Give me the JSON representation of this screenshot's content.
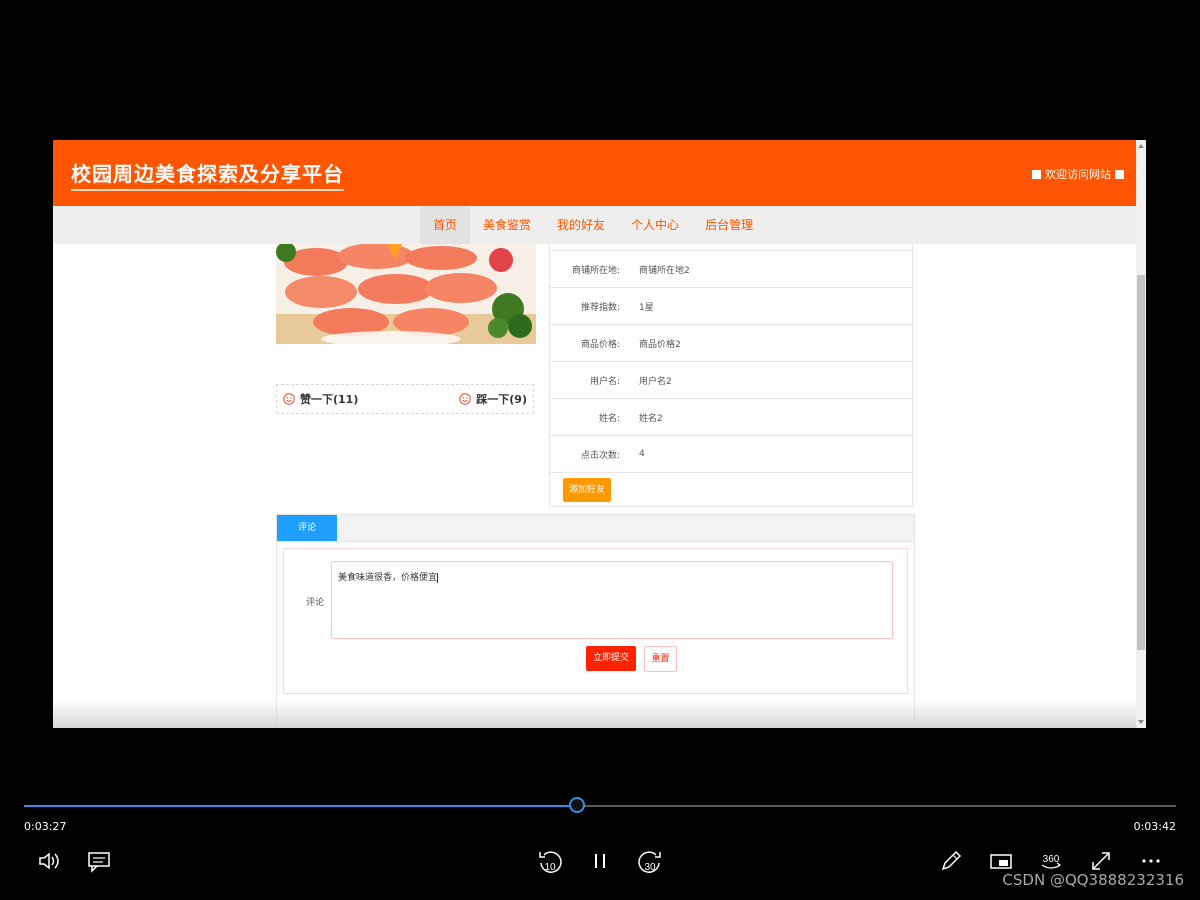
{
  "site": {
    "title": "校园周边美食探索及分享平台",
    "welcome": "欢迎访问网站"
  },
  "nav": {
    "items": [
      {
        "label": "首页",
        "active": true
      },
      {
        "label": "美食鉴赏",
        "active": false
      },
      {
        "label": "我的好友",
        "active": false
      },
      {
        "label": "个人中心",
        "active": false
      },
      {
        "label": "后台管理",
        "active": false
      }
    ]
  },
  "votes": {
    "like_label": "赞一下(11)",
    "dislike_label": "踩一下(9)"
  },
  "info": {
    "rows": [
      {
        "label": "商铺所在地:",
        "value": "商铺所在地2"
      },
      {
        "label": "推荐指数:",
        "value": "1星"
      },
      {
        "label": "商品价格:",
        "value": "商品价格2"
      },
      {
        "label": "用户名:",
        "value": "用户名2"
      },
      {
        "label": "姓名:",
        "value": "姓名2"
      },
      {
        "label": "点击次数:",
        "value": "4"
      }
    ],
    "add_friend_label": "添加好友"
  },
  "comment": {
    "tab_label": "评论",
    "field_label": "评论",
    "text_value": "美食味道很香，价格便宜",
    "submit_label": "立即提交",
    "reset_label": "重置"
  },
  "player": {
    "current_time": "0:03:27",
    "total_time": "0:03:42",
    "progress": 0.48,
    "skip_back_seconds": "10",
    "skip_forward_seconds": "30",
    "view_360": "360"
  },
  "watermark": "CSDN @QQ3888232316",
  "colors": {
    "header": "#ff5500",
    "tab": "#1e9fff",
    "submit": "#ff2200",
    "add_friend": "#ff9900",
    "progress": "#3a8ee6"
  }
}
